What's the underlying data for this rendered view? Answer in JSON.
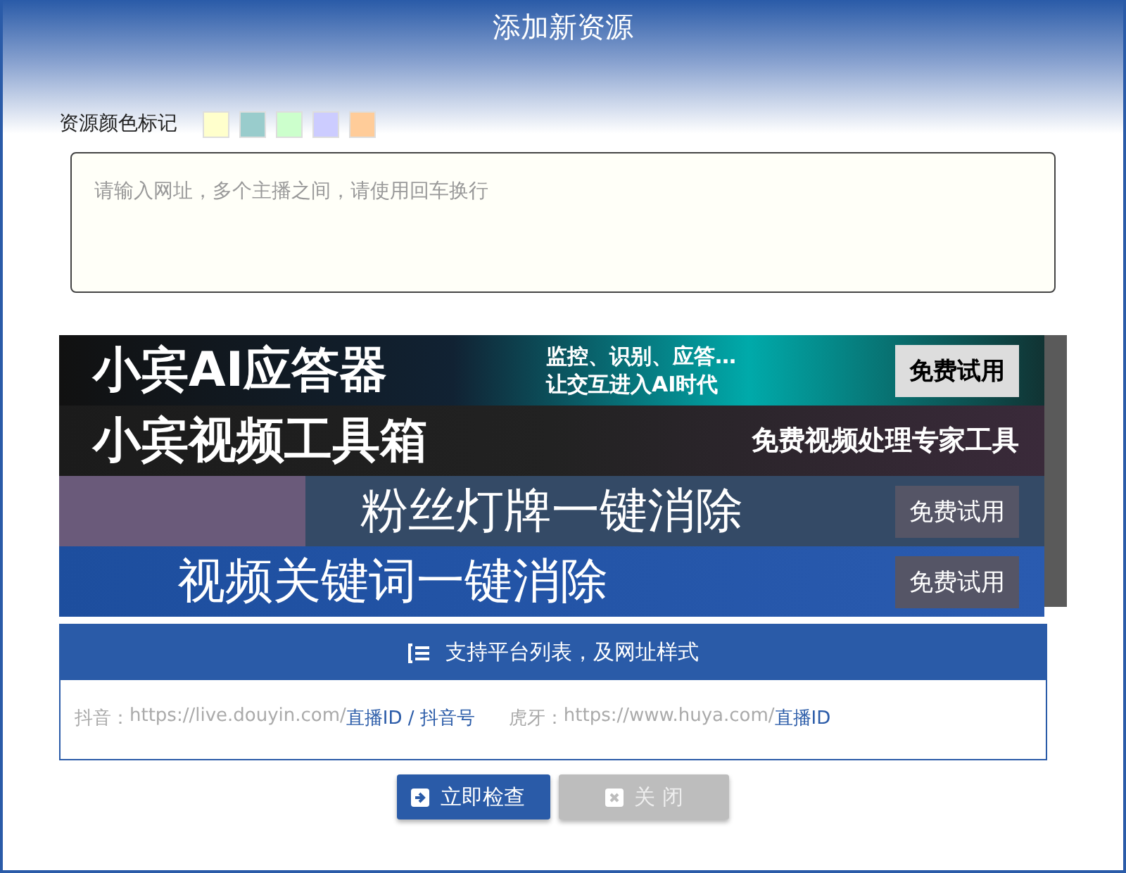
{
  "window": {
    "title": "添加新资源"
  },
  "color_marks": {
    "label": "资源颜色标记",
    "swatches": [
      {
        "color": "#ffffcc"
      },
      {
        "color": "#99cccc"
      },
      {
        "color": "#ccffcc"
      },
      {
        "color": "#ccccff"
      },
      {
        "color": "#ffcc99"
      }
    ]
  },
  "url_input": {
    "placeholder": "请输入网址，多个主播之间，请使用回车换行"
  },
  "banners": [
    {
      "title": "小宾AI应答器",
      "subtitle": "监控、识别、应答…",
      "subtitle_2": "让交互进入AI时代",
      "action": "免费试用"
    },
    {
      "title": "小宾视频工具箱",
      "subtitle": "免费视频处理专家工具"
    },
    {
      "title": "粉丝灯牌一键消除",
      "action": "免费试用"
    },
    {
      "title": "视频关键词一键消除",
      "action": "免费试用"
    }
  ],
  "platforms": {
    "heading": "支持平台列表，及网址样式",
    "items": [
      {
        "name": "抖音：",
        "url": "https://live.douyin.com/",
        "pattern": "直播ID / 抖音号"
      },
      {
        "name": "虎牙：",
        "url": "https://www.huya.com/",
        "pattern": "直播ID"
      }
    ]
  },
  "buttons": [
    {
      "label": "立即检查",
      "kind": "primary",
      "disabled": false
    },
    {
      "label": "关 闭",
      "kind": "close",
      "disabled": true
    }
  ]
}
